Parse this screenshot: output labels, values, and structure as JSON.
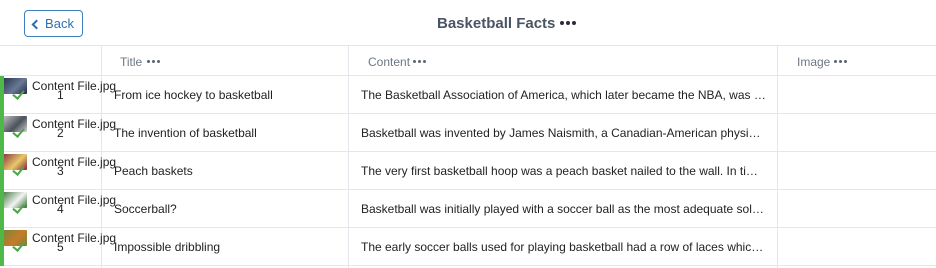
{
  "header": {
    "back_label": "Back",
    "title": "Basketball Facts"
  },
  "columns": {
    "title": "Title",
    "content": "Content",
    "image": "Image"
  },
  "rows": [
    {
      "num": "1",
      "title": "From ice hockey to basketball",
      "content": "The Basketball Association of America, which later became the NBA, was found…",
      "image": "Content File.jpg",
      "thumb_icon": "team-photo-thumbnail",
      "thumb_colors": [
        "#1d2a44",
        "#6a7a94"
      ]
    },
    {
      "num": "2",
      "title": "The invention of basketball",
      "content": "Basketball was invented by James Naismith, a Canadian-American physical ed…",
      "image": "Content File.jpg",
      "thumb_icon": "portrait-thumbnail",
      "thumb_colors": [
        "#cfd2d6",
        "#4c525a"
      ]
    },
    {
      "num": "3",
      "title": "Peach baskets",
      "content": "The very first basketball hoop was a peach basket nailed to the wall. In time, its …",
      "image": "Content File.jpg",
      "thumb_icon": "basket-thumbnail",
      "thumb_colors": [
        "#7a2438",
        "#e8c86a"
      ]
    },
    {
      "num": "4",
      "title": "Soccerball?",
      "content": "Basketball was initially played with a soccer ball as the most adequate solution.",
      "image": "Content File.jpg",
      "thumb_icon": "soccer-ball-thumbnail",
      "thumb_colors": [
        "#2e6b2a",
        "#f4f4f4"
      ]
    },
    {
      "num": "5",
      "title": "Impossible dribbling",
      "content": "The early soccer balls used for playing basketball had a row of laces which seal…",
      "image": "Content File.jpg",
      "thumb_icon": "ball-thumbnail",
      "thumb_colors": [
        "#6b8a3a",
        "#c87a2a"
      ]
    }
  ],
  "colors": {
    "accent": "#3d7fc1",
    "status_green": "#4fb848",
    "border": "#e3e6ea"
  }
}
